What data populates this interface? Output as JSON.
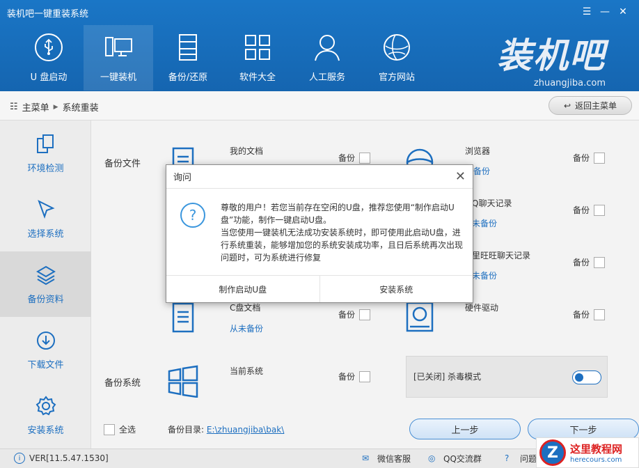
{
  "app": {
    "title": "装机吧一键重装系统"
  },
  "window_controls": [
    "menu-icon",
    "minimize-icon",
    "close-icon"
  ],
  "nav": [
    {
      "label": "U 盘启动",
      "icon": "usb-icon",
      "active": false
    },
    {
      "label": "一键装机",
      "icon": "computer-icon",
      "active": true
    },
    {
      "label": "备份/还原",
      "icon": "backup-icon",
      "active": false
    },
    {
      "label": "软件大全",
      "icon": "apps-grid-icon",
      "active": false
    },
    {
      "label": "人工服务",
      "icon": "user-icon",
      "active": false
    },
    {
      "label": "官方网站",
      "icon": "globe-icon",
      "active": false
    }
  ],
  "brand": {
    "logo": "装机吧",
    "site": "zhuangjiba.com"
  },
  "breadcrumb": {
    "root": "主菜单",
    "current": "系统重装"
  },
  "back_button": "返回主菜单",
  "sidebar": [
    {
      "label": "环境检测",
      "icon": "environment-check-icon",
      "active": false
    },
    {
      "label": "选择系统",
      "icon": "cursor-icon",
      "active": false
    },
    {
      "label": "备份资料",
      "icon": "layers-icon",
      "active": true
    },
    {
      "label": "下载文件",
      "icon": "download-icon",
      "active": false
    },
    {
      "label": "安装系统",
      "icon": "gear-icon",
      "active": false
    }
  ],
  "backup_files_label": "备份文件",
  "backup_system_label": "备份系统",
  "backup_label": "备份",
  "items_left": [
    {
      "name": "我的文档",
      "sub": ""
    },
    {
      "name": "C盘文档",
      "sub": "从未备份"
    },
    {
      "name": "当前系统",
      "sub": ""
    }
  ],
  "items_right": [
    {
      "name": "浏览器",
      "sub": "未备份"
    },
    {
      "name": "Q聊天记录",
      "sub": "未备份"
    },
    {
      "name": "里旺旺聊天记录",
      "sub": "未备份"
    },
    {
      "name": "硬件驱动",
      "sub": ""
    }
  ],
  "antivirus": {
    "label": "[已关闭] 杀毒模式"
  },
  "footer": {
    "select_all": "全选",
    "backup_dir_label": "备份目录:",
    "backup_dir_path": "E:\\zhuangjiba\\bak\\",
    "prev": "上一步",
    "next": "下一步"
  },
  "status": {
    "version": "VER[11.5.47.1530]",
    "wechat": "微信客服",
    "qq": "QQ交流群",
    "feedback": "问题"
  },
  "watermark": {
    "title": "这里教程网",
    "url": "herecours.com"
  },
  "dialog": {
    "title": "询问",
    "message_1": "尊敬的用户！若您当前存在空闲的U盘，推荐您使用“制作启动U盘”功能，制作一键启动U盘。",
    "message_2": "当您使用一键装机无法成功安装系统时，即可使用此启动U盘，进行系统重装，能够增加您的系统安装成功率，且日后系统再次出现问题时，可为系统进行修复",
    "btn_usb": "制作启动U盘",
    "btn_install": "安装系统"
  }
}
